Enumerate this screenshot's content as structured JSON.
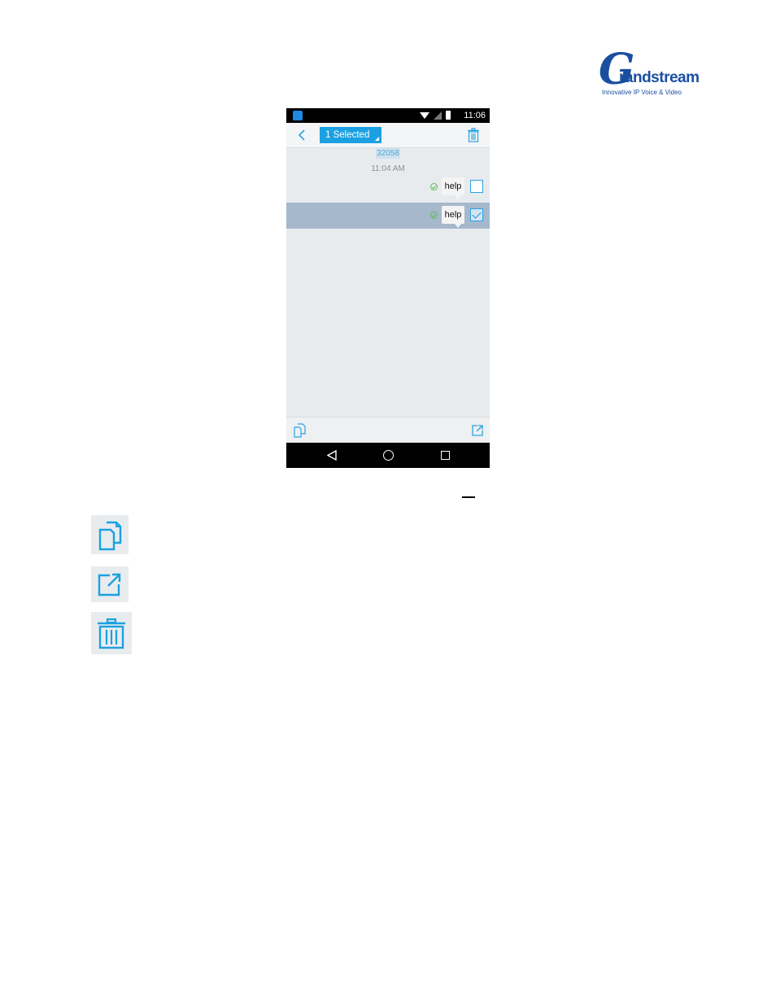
{
  "logo": {
    "mark": "G",
    "word": "randstream",
    "tagline": "Innovative IP Voice & Video"
  },
  "phone": {
    "status_bar": {
      "clock": "11:06"
    },
    "action_bar": {
      "selection_label": "1 Selected"
    },
    "conversation": {
      "contact_number": "32058",
      "timestamp": "11:04 AM",
      "messages": [
        {
          "text": "help",
          "selected": false
        },
        {
          "text": "help",
          "selected": true
        }
      ]
    }
  },
  "icons": [
    "copy-icon",
    "forward-icon",
    "trash-icon"
  ],
  "colors": {
    "accent": "#1ba1e2",
    "selected_row": "#a5b8cc",
    "brand": "#1a4fa0"
  }
}
